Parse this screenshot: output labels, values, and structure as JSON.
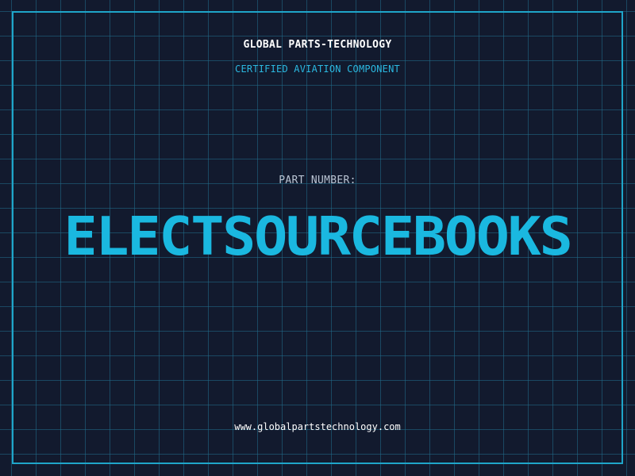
{
  "header": {
    "company": "GLOBAL PARTS-TECHNOLOGY",
    "subtitle": "CERTIFIED AVIATION COMPONENT"
  },
  "part": {
    "label": "PART NUMBER:",
    "number": "ELECTSOURCEBOOKS"
  },
  "footer": {
    "website": "www.globalpartstechnology.com"
  },
  "colors": {
    "background": "#121a2e",
    "grid": "#226e8c",
    "accent": "#1ab8e0",
    "text": "#ffffff",
    "muted": "#b9c4d3"
  }
}
